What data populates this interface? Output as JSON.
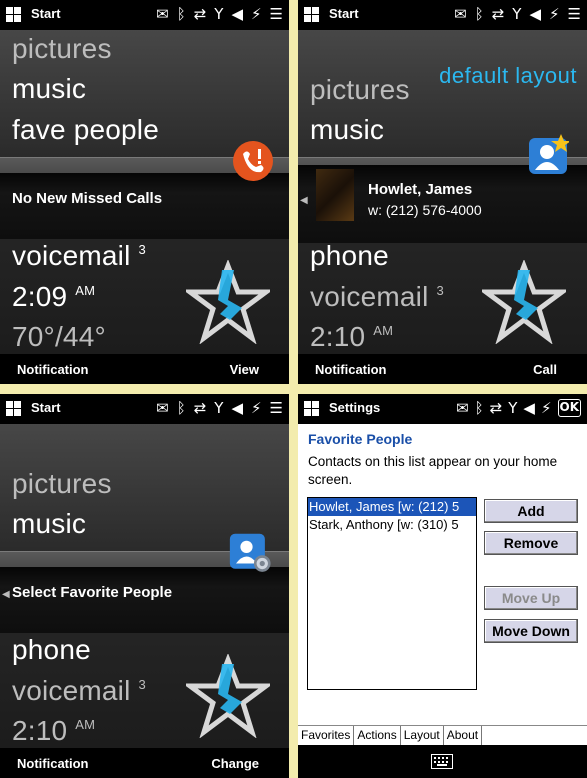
{
  "colors": {
    "accent_blue": "#2bb8f0",
    "settings_heading": "#1a4fa8",
    "selection": "#1c55b8",
    "page_bg": "#f3ecad"
  },
  "panel1": {
    "status_title": "Start",
    "items": [
      "pictures",
      "music",
      "fave people"
    ],
    "mid_text": "No New Missed Calls",
    "voicemail": "voicemail",
    "voicemail_count": "3",
    "time": "2:09",
    "ampm": "AM",
    "weather": "70°/44°",
    "soft_left": "Notification",
    "soft_right": "View"
  },
  "panel2": {
    "status_title": "Start",
    "layout_label": "default layout",
    "items": [
      "pictures",
      "music"
    ],
    "contact_name": "Howlet, James",
    "contact_phone": "w: (212) 576-4000",
    "phone": "phone",
    "voicemail": "voicemail",
    "voicemail_count": "3",
    "time": "2:10",
    "ampm": "AM",
    "soft_left": "Notification",
    "soft_right": "Call"
  },
  "panel3": {
    "status_title": "Start",
    "items": [
      "pictures",
      "music"
    ],
    "mid_text": "Select Favorite People",
    "phone": "phone",
    "voicemail": "voicemail",
    "voicemail_count": "3",
    "time": "2:10",
    "ampm": "AM",
    "soft_left": "Notification",
    "soft_right": "Change"
  },
  "panel4": {
    "status_title": "Settings",
    "heading": "Favorite People",
    "description": "Contacts on this list appear on your home screen.",
    "contacts": [
      "Howlet, James [w: (212) 5",
      "Stark, Anthony [w: (310) 5"
    ],
    "buttons": {
      "add": "Add",
      "remove": "Remove",
      "move_up": "Move Up",
      "move_down": "Move Down"
    },
    "tabs": [
      "Favorites",
      "Actions",
      "Layout",
      "About"
    ]
  },
  "status_icons": [
    "message-icon",
    "bluetooth-icon",
    "sync-icon",
    "signal-icon",
    "volume-icon",
    "power-icon",
    "menu-icon"
  ]
}
